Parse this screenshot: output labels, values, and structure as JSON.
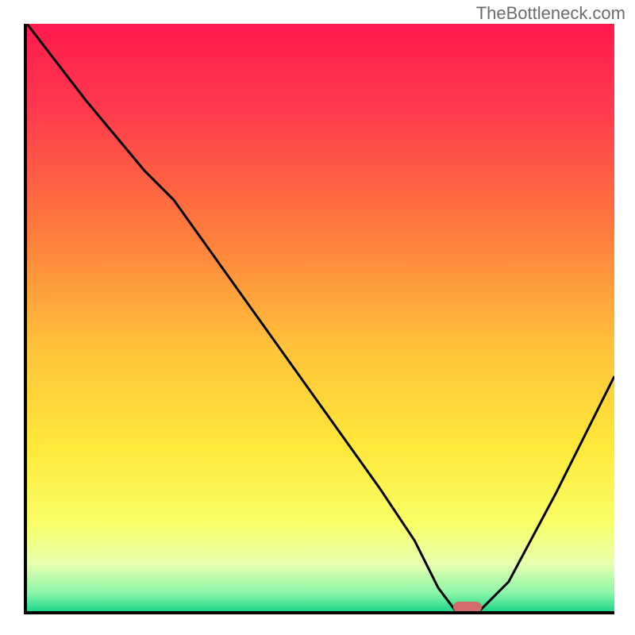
{
  "watermark": "TheBottleneck.com",
  "chart_data": {
    "type": "line",
    "title": "",
    "xlabel": "",
    "ylabel": "",
    "xlim": [
      0,
      100
    ],
    "ylim": [
      0,
      100
    ],
    "gradient_stops": [
      {
        "offset": 0,
        "color": "#ff1a4d"
      },
      {
        "offset": 15,
        "color": "#ff3b4d"
      },
      {
        "offset": 35,
        "color": "#ff7a3d"
      },
      {
        "offset": 55,
        "color": "#ffc23a"
      },
      {
        "offset": 72,
        "color": "#ffe83a"
      },
      {
        "offset": 85,
        "color": "#f8ff66"
      },
      {
        "offset": 92,
        "color": "#e8ffb0"
      },
      {
        "offset": 97,
        "color": "#88f5a8"
      },
      {
        "offset": 100,
        "color": "#1fd68a"
      }
    ],
    "series": [
      {
        "name": "bottleneck-curve",
        "x": [
          0,
          10,
          20,
          25,
          30,
          40,
          50,
          60,
          66,
          70,
          73,
          77,
          82,
          90,
          100
        ],
        "y": [
          100,
          87,
          75,
          70,
          63,
          49,
          35,
          21,
          12,
          4,
          0,
          0,
          5,
          20,
          40
        ]
      }
    ],
    "marker": {
      "x": 75,
      "y": 0,
      "name": "optimal-point"
    }
  }
}
